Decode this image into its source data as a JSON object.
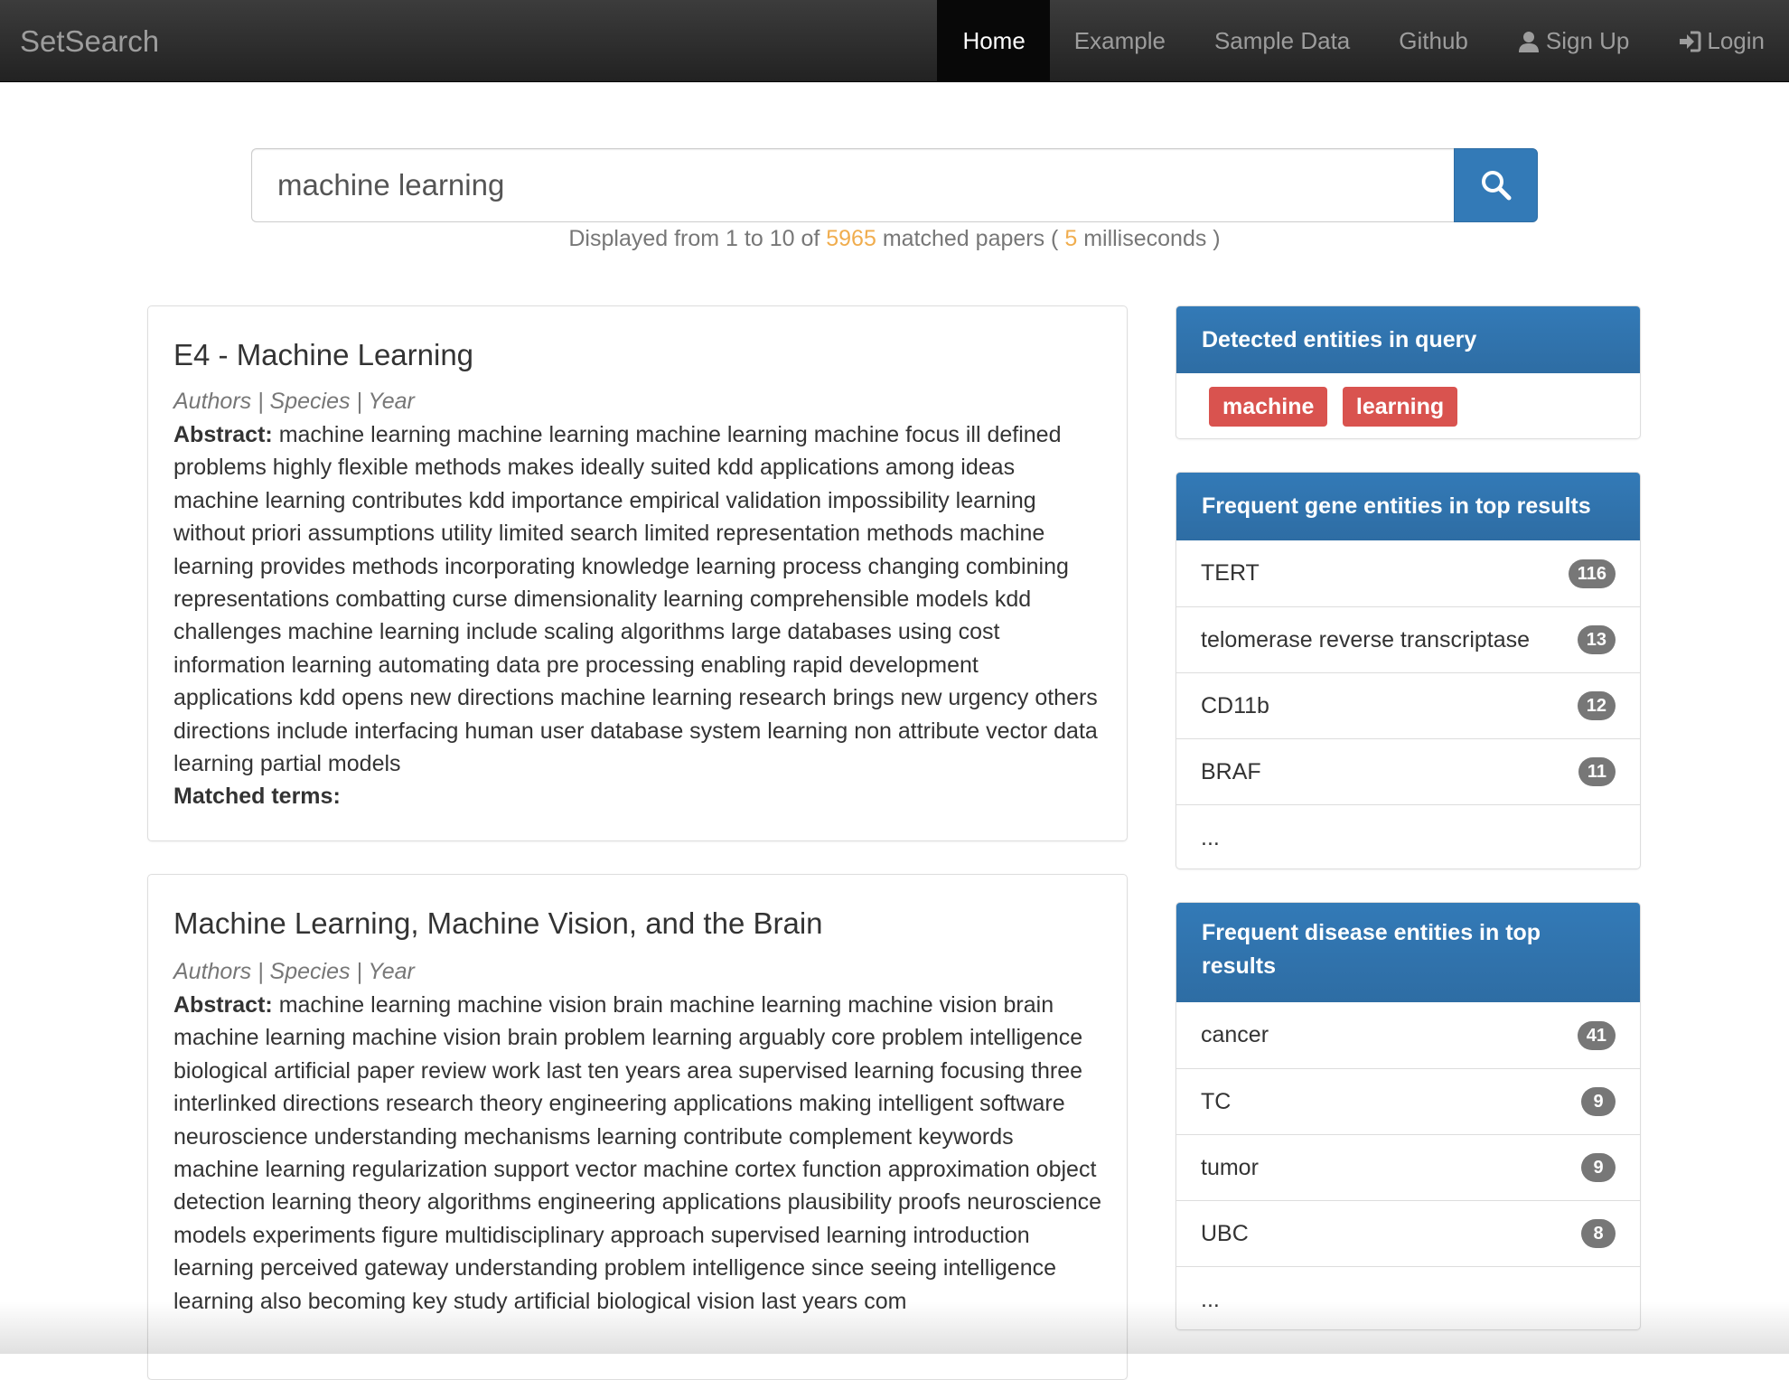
{
  "navbar": {
    "brand": "SetSearch",
    "items": [
      {
        "label": "Home",
        "active": true
      },
      {
        "label": "Example"
      },
      {
        "label": "Sample Data"
      },
      {
        "label": "Github"
      },
      {
        "label": "Sign Up",
        "icon": "user-icon"
      },
      {
        "label": "Login",
        "icon": "login-icon"
      }
    ]
  },
  "search": {
    "value": "machine learning",
    "button_icon": "search-icon",
    "status": {
      "prefix": "Displayed from 1 to 10 of",
      "count": "5965",
      "middle": "matched papers (",
      "ms": "5",
      "suffix": "milliseconds )"
    }
  },
  "results": [
    {
      "title": "E4 - Machine Learning",
      "meta": "Authors | Species | Year",
      "abstract_label": "Abstract:",
      "abstract": "machine learning machine learning machine learning machine focus ill defined problems highly flexible methods makes ideally suited kdd applications among ideas machine learning contributes kdd importance empirical validation impossibility learning without priori assumptions utility limited search limited representation methods machine learning provides methods incorporating knowledge learning process changing combining representations combatting curse dimensionality learning comprehensible models kdd challenges machine learning include scaling algorithms large databases using cost information learning automating data pre processing enabling rapid development applications kdd opens new directions machine learning research brings new urgency others directions include interfacing human user database system learning non attribute vector data learning partial models",
      "matched_label": "Matched terms:"
    },
    {
      "title": "Machine Learning, Machine Vision, and the Brain",
      "meta": "Authors | Species | Year",
      "abstract_label": "Abstract:",
      "abstract": "machine learning machine vision brain machine learning machine vision brain machine learning machine vision brain problem learning arguably core problem intelligence biological artificial paper review work last ten years area supervised learning focusing three interlinked directions research theory engineering applications making intelligent software neuroscience understanding mechanisms learning contribute complement keywords machine learning regularization support vector machine cortex function approximation object detection learning theory algorithms engineering applications plausibility proofs neuroscience models experiments figure multidisciplinary approach supervised learning introduction learning perceived gateway understanding problem intelligence since seeing intelligence learning also becoming key study artificial biological vision last years com"
    }
  ],
  "sidebar": {
    "query_entities": {
      "title": "Detected entities in query",
      "labels": [
        "machine",
        "learning"
      ]
    },
    "gene_entities": {
      "title": "Frequent gene entities in top results",
      "rows": [
        {
          "name": "TERT",
          "count": "116"
        },
        {
          "name": "telomerase reverse transcriptase",
          "count": "13"
        },
        {
          "name": "CD11b",
          "count": "12"
        },
        {
          "name": "BRAF",
          "count": "11"
        }
      ],
      "more": "..."
    },
    "disease_entities": {
      "title_line1": "Frequent disease entities in top",
      "title_line2": "results",
      "rows": [
        {
          "name": "cancer",
          "count": "41"
        },
        {
          "name": "TC",
          "count": "9"
        },
        {
          "name": "tumor",
          "count": "9"
        },
        {
          "name": "UBC",
          "count": "8"
        }
      ],
      "more": "..."
    }
  },
  "colors": {
    "navbar": "#222222",
    "primary": "#337ab7",
    "danger": "#d9534f",
    "highlight": "#f0ad4e",
    "badge": "#777777"
  }
}
